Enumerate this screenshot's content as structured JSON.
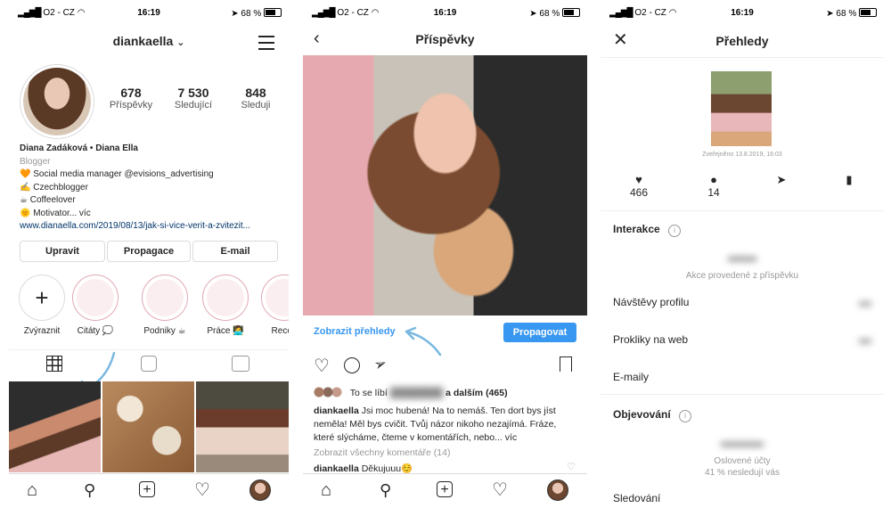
{
  "status_bar": {
    "carrier": "O2 - CZ",
    "time": "16:19",
    "battery": "68 %"
  },
  "profile_screen": {
    "username": "diankaella",
    "stats": [
      {
        "value": "678",
        "label": "Příspěvky"
      },
      {
        "value": "7 530",
        "label": "Sledující"
      },
      {
        "value": "848",
        "label": "Sleduji"
      }
    ],
    "bio": {
      "name": "Diana Zadáková • Diana Ella",
      "category": "Blogger",
      "lines": [
        "🧡 Social media manager @evisions_advertising",
        "✍️ Czechblogger",
        "☕ Coffeelover",
        "🌞 Motivator... víc"
      ],
      "link": "www.dianaella.com/2019/08/13/jak-si-vice-verit-a-zvitezit..."
    },
    "buttons": {
      "edit": "Upravit",
      "promote": "Propagace",
      "email": "E-mail"
    },
    "highlights": [
      {
        "label": "Zvýraznit"
      },
      {
        "label": "Citáty 💭"
      },
      {
        "label": "Podniky ☕"
      },
      {
        "label": "Práce 👩‍💻"
      },
      {
        "label": "Recep"
      }
    ]
  },
  "post_screen": {
    "title": "Příspěvky",
    "insights_link": "Zobrazit přehledy",
    "promote_button": "Propagovat",
    "likes": {
      "prefix": "To se líbí",
      "suffix": "a dalším (465)"
    },
    "caption": {
      "user": "diankaella",
      "text": "Jsi moc hubená! Na to nemáš. Ten dort bys jíst neměla! Měl bys cvičit. Tvůj názor nikoho nezajímá. Fráze, které slýcháme, čteme v komentářích, nebo... víc"
    },
    "view_comments": "Zobrazit všechny komentáře (14)",
    "comment": {
      "user": "diankaella",
      "text": "Děkujuuu☺️"
    }
  },
  "insights_screen": {
    "title": "Přehledy",
    "published": "Zveřejněno 13.8.2019, 16:03",
    "metrics": [
      {
        "icon": "heart-icon",
        "value": "466"
      },
      {
        "icon": "comment-icon",
        "value": "14"
      },
      {
        "icon": "share-icon",
        "value": ""
      },
      {
        "icon": "bookmark-icon",
        "value": ""
      }
    ],
    "interactions_title": "Interakce",
    "interactions_caption": "Akce provedené z příspěvku",
    "rows": [
      "Návštěvy profilu",
      "Prokliky na web",
      "E-maily"
    ],
    "discovery_title": "Objevování",
    "discovery_caption1": "Oslovené účty",
    "discovery_caption2": "41 % nesledují vás",
    "following_row": "Sledování"
  }
}
